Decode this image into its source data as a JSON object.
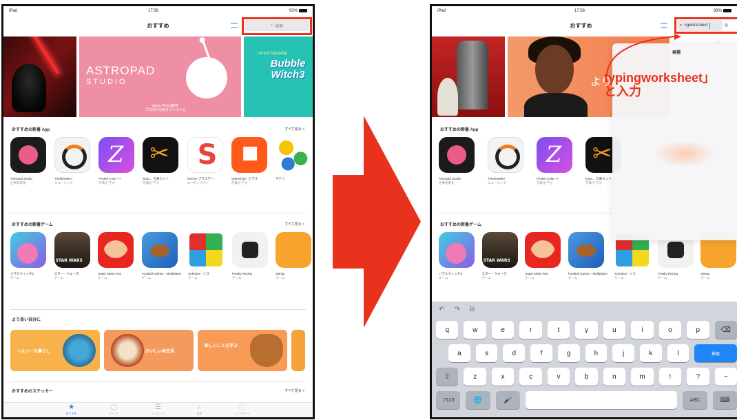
{
  "colors": {
    "highlight": "#e8321e",
    "arrow": "#e8321e",
    "tab_active": "#2f7bf0"
  },
  "left": {
    "status": {
      "left": "iPad",
      "time": "17:56",
      "battery": "93%"
    },
    "nav_title": "おすすめ",
    "search_placeholder": "検索",
    "banners": {
      "astropad_title": "ASTROPAD",
      "astropad_sub": "STUDIO",
      "astropad_caption": "Apple Pencil専用\nプロ向けの液タブシステム",
      "bubble_tag": "LATEST RELEASE",
      "bubble_title": "Bubble Witch3"
    },
    "section1": {
      "title": "おすすめの新着 App",
      "see_all": "すべて見る >"
    },
    "apps1": [
      {
        "icon": "astropad-app-icon",
        "name": "Astropad Studio",
        "cat": "仕事効率化"
      },
      {
        "icon": "timer-app-icon",
        "name": "Timebreaker",
        "cat": "ミュージック"
      },
      {
        "icon": "pocket-color-icon",
        "name": "Pocket Color ++",
        "cat": "写真/ビデオ"
      },
      {
        "icon": "scissors-app-icon",
        "name": "Expo... 写真カット",
        "cat": "写真/ビデオ"
      },
      {
        "icon": "sincho-app-icon",
        "name": "Sincho! プラスデー",
        "cat": "ユーティリティ"
      },
      {
        "icon": "video-app-icon",
        "name": "Videoshop - ビデオ",
        "cat": "写真/ビデオ"
      },
      {
        "icon": "dots-app-icon",
        "name": "マテリ",
        "cat": ""
      }
    ],
    "section2": {
      "title": "おすすめの新着ゲーム",
      "see_all": "すべて見る >"
    },
    "apps2": [
      {
        "icon": "bubble-witch-icon",
        "name": "バブルウィッチ3",
        "cat": "ゲーム"
      },
      {
        "icon": "star-wars-icon",
        "name": "スター・ウォーズ",
        "cat": "ゲーム"
      },
      {
        "icon": "super-mario-icon",
        "name": "Super Mario Run",
        "cat": "ゲーム"
      },
      {
        "icon": "football-icon",
        "name": "Football Games - Multiplayer",
        "cat": "ゲーム"
      },
      {
        "icon": "sokoban-icon",
        "name": "Sokobus - ソコ",
        "cat": "ゲーム"
      },
      {
        "icon": "freaky-racing-icon",
        "name": "Freaky Racing",
        "cat": "ゲーム"
      },
      {
        "icon": "dango-icon",
        "name": "Dango",
        "cat": "ゲーム"
      }
    ],
    "section3": {
      "title": "よう良い自分に"
    },
    "collections": [
      "ヘルシーな暮らし",
      "おいしい食生活",
      "新しいことを学ぶ"
    ],
    "section4": {
      "title": "おすすめのステッカー",
      "see_all": "すべて見る >"
    },
    "tabs": [
      {
        "icon": "star-tab-icon",
        "glyph": "★",
        "label": "おすすめ"
      },
      {
        "icon": "categories-tab-icon",
        "glyph": "▢",
        "label": "カテゴリ"
      },
      {
        "icon": "ranking-tab-icon",
        "glyph": "☰",
        "label": "ランキング"
      },
      {
        "icon": "search-tab-icon",
        "glyph": "⌕",
        "label": "検索"
      },
      {
        "icon": "updates-tab-icon",
        "glyph": "⬚",
        "label": "アップデート"
      }
    ]
  },
  "right": {
    "status": {
      "left": "iPad",
      "time": "17:56",
      "battery": "93%"
    },
    "nav_title": "おすすめ",
    "search_value": "ngworksheet",
    "banner_text": "より",
    "popover_title": "候補",
    "annotation_line1": "typingworksheet」",
    "annotation_line2": "と入力",
    "section1": {
      "title": "おすすめの新着 App"
    },
    "section2": {
      "title": "おすすめの新着ゲーム"
    },
    "keyboard": {
      "row1": [
        "q",
        "w",
        "e",
        "r",
        "t",
        "y",
        "u",
        "i",
        "o",
        "p",
        "⌫"
      ],
      "row2": [
        "a",
        "s",
        "d",
        "f",
        "g",
        "h",
        "j",
        "k",
        "l",
        "検索"
      ],
      "row3": [
        "⇧",
        "z",
        "x",
        "c",
        "v",
        "b",
        "n",
        "m",
        "!",
        "?",
        "−"
      ],
      "row4": [
        ".?123",
        "🌐",
        "🎤",
        "",
        "ABC",
        "⌨"
      ]
    }
  }
}
